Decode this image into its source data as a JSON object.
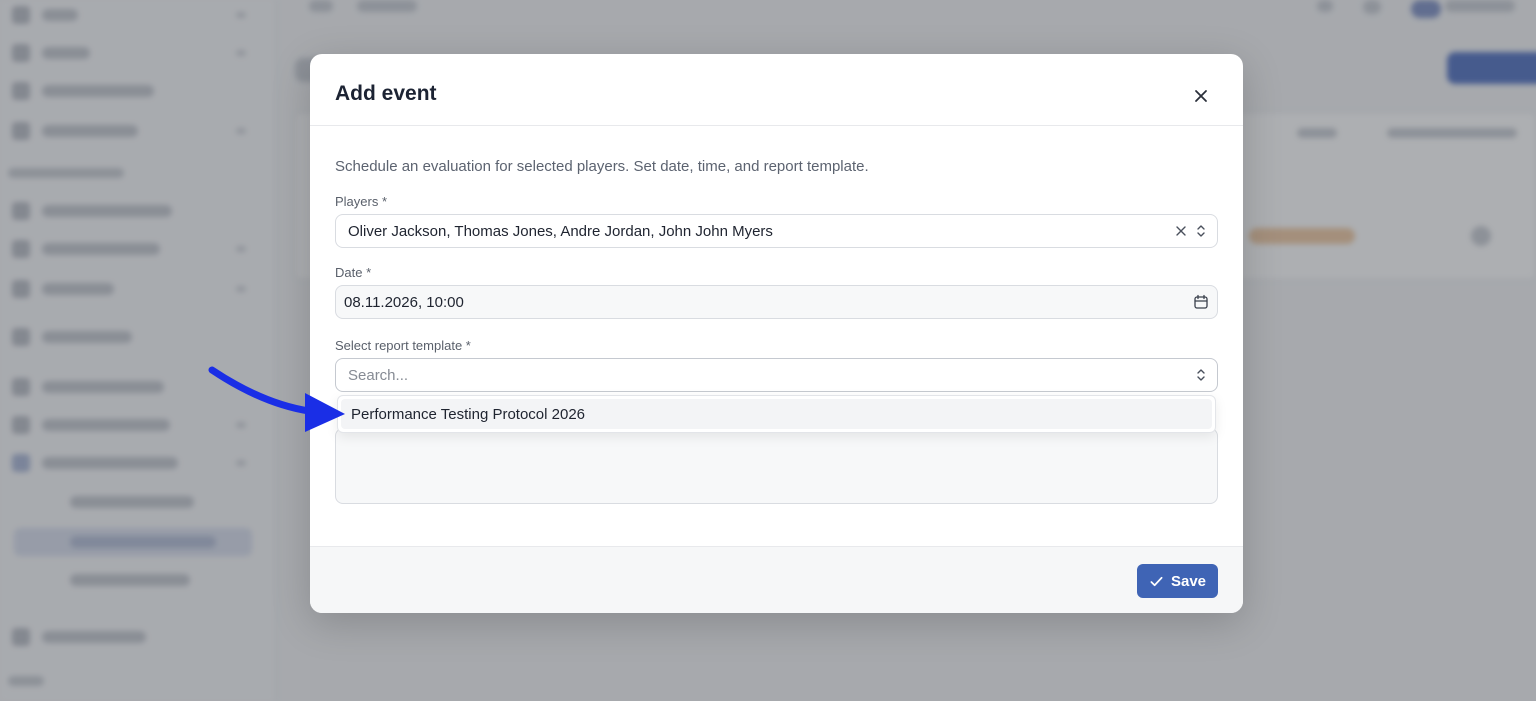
{
  "modal": {
    "title": "Add event",
    "description": "Schedule an evaluation for selected players. Set date, time, and report template.",
    "players": {
      "label": "Players *",
      "value": "Oliver Jackson, Thomas Jones, Andre Jordan, John John Myers"
    },
    "date": {
      "label": "Date *",
      "value": "08.11.2026, 10:00"
    },
    "template": {
      "label": "Select report template *",
      "placeholder": "Search...",
      "options": [
        "Performance Testing Protocol 2026"
      ]
    },
    "save_label": "Save"
  },
  "icons": {
    "close": "close-icon",
    "clear": "clear-icon",
    "chevrons": "chevron-up-down-icon",
    "calendar": "calendar-icon",
    "check": "check-icon"
  },
  "colors": {
    "primary": "#3f64b5",
    "annotation_arrow": "#1a2ee6"
  }
}
